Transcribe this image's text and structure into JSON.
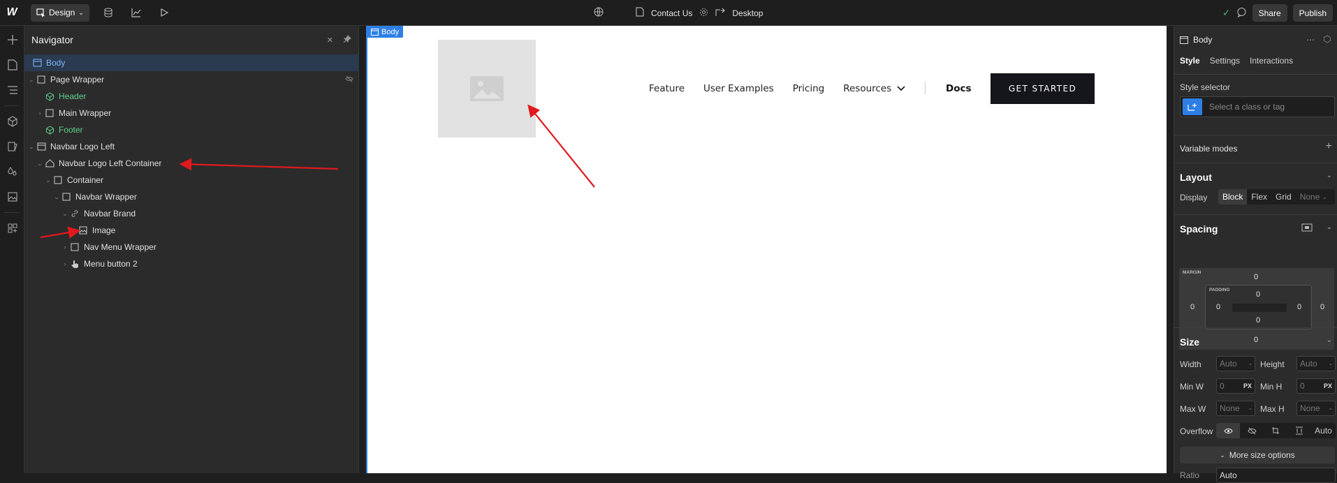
{
  "topbar": {
    "mode_label": "Design",
    "page_name": "Contact Us",
    "breakpoint_label": "Desktop",
    "share_label": "Share",
    "publish_label": "Publish"
  },
  "navigator": {
    "title": "Navigator",
    "items": [
      {
        "label": "Body",
        "depth": 0
      },
      {
        "label": "Page Wrapper",
        "depth": 0
      },
      {
        "label": "Header",
        "depth": 1
      },
      {
        "label": "Main Wrapper",
        "depth": 1
      },
      {
        "label": "Footer",
        "depth": 1
      },
      {
        "label": "Navbar Logo Left",
        "depth": 0
      },
      {
        "label": "Navbar Logo Left Container",
        "depth": 1
      },
      {
        "label": "Container",
        "depth": 2
      },
      {
        "label": "Navbar Wrapper",
        "depth": 3
      },
      {
        "label": "Navbar Brand",
        "depth": 4
      },
      {
        "label": "Image",
        "depth": 5
      },
      {
        "label": "Nav Menu Wrapper",
        "depth": 4
      },
      {
        "label": "Menu button 2",
        "depth": 4
      }
    ]
  },
  "canvas": {
    "tag_label": "Body",
    "site_nav": {
      "links": [
        "Feature",
        "User Examples",
        "Pricing",
        "Resources"
      ],
      "docs_label": "Docs",
      "cta_label": "GET STARTED"
    }
  },
  "right_panel": {
    "element_name": "Body",
    "tabs": [
      "Style",
      "Settings",
      "Interactions"
    ],
    "style_selector_label": "Style selector",
    "selector_placeholder": "Select a class or tag",
    "variable_modes_label": "Variable modes",
    "layout": {
      "title": "Layout",
      "display_label": "Display",
      "display_options": [
        "Block",
        "Flex",
        "Grid",
        "None"
      ]
    },
    "spacing": {
      "title": "Spacing",
      "margin_label": "MARGIN",
      "padding_label": "PADDING",
      "margin": {
        "top": "0",
        "right": "0",
        "bottom": "0",
        "left": "0"
      },
      "padding": {
        "top": "0",
        "right": "0",
        "bottom": "0",
        "left": "0"
      }
    },
    "size": {
      "title": "Size",
      "width_label": "Width",
      "width_value": "Auto",
      "height_label": "Height",
      "height_value": "Auto",
      "min_w_label": "Min W",
      "min_w_value": "0",
      "min_h_label": "Min H",
      "min_h_value": "0",
      "max_w_label": "Max W",
      "max_w_value": "None",
      "max_h_label": "Max H",
      "max_h_value": "None",
      "unit": "PX",
      "overflow_label": "Overflow",
      "overflow_auto": "Auto",
      "more_label": "More size options",
      "dash": "-"
    },
    "ratio_label": "Ratio",
    "ratio_value": "Auto"
  },
  "colors": {
    "accent": "#2d7fe6",
    "annotation_arrow": "#e0191e",
    "component_green": "#5ed18d"
  }
}
